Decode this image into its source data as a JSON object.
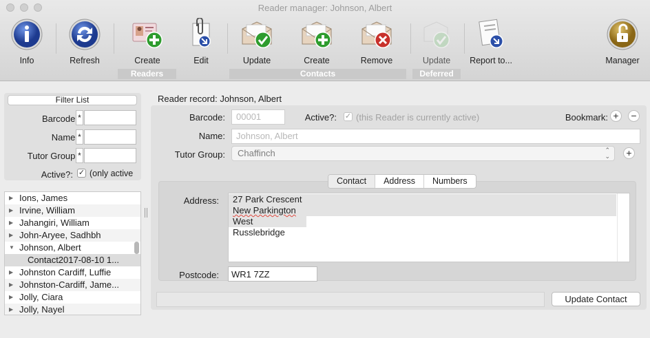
{
  "window": {
    "title": "Reader manager: Johnson, Albert"
  },
  "toolbar": {
    "info": "Info",
    "refresh": "Refresh",
    "create_reader": "Create",
    "edit": "Edit",
    "update_contact": "Update",
    "create_contact": "Create",
    "remove": "Remove",
    "update_deferred": "Update",
    "report": "Report to...",
    "manager": "Manager",
    "groups": {
      "readers": "Readers",
      "contacts": "Contacts",
      "deferred": "Deferred"
    }
  },
  "filter": {
    "button": "Filter List",
    "barcode_label": "Barcode:",
    "name_label": "Name:",
    "tutor_label": "Tutor Group:",
    "active_label": "Active?:",
    "active_text": "(only active",
    "wildcard": "*"
  },
  "list": {
    "items": [
      {
        "name": "Ions,  James",
        "expanded": false
      },
      {
        "name": "Irvine,  William",
        "expanded": false
      },
      {
        "name": "Jahangiri,  William",
        "expanded": false
      },
      {
        "name": "John-Aryee,  Sadhbh",
        "expanded": false
      },
      {
        "name": "Johnson, Albert",
        "expanded": true
      },
      {
        "name": "Contact2017-08-10 1...",
        "child": true
      },
      {
        "name": "Johnston Cardiff,  Luffie",
        "expanded": false
      },
      {
        "name": "Johnston-Cardiff,  Jame...",
        "expanded": false
      },
      {
        "name": "Jolly,  Ciara",
        "expanded": false
      },
      {
        "name": "Jolly,  Nayel",
        "expanded": false
      }
    ]
  },
  "record": {
    "heading": "Reader record: Johnson, Albert",
    "barcode_label": "Barcode:",
    "barcode_value": "00001",
    "active_label": "Active?:",
    "active_text": "(this Reader is currently active)",
    "bookmark_label": "Bookmark:",
    "name_label": "Name:",
    "name_value": "Johnson, Albert",
    "tutor_label": "Tutor Group:",
    "tutor_value": "Chaffinch",
    "tabs": [
      "Contact",
      "Address",
      "Numbers"
    ],
    "active_tab": "Contact",
    "address_label": "Address:",
    "address_lines": [
      "27 Park Crescent",
      "New Parkington",
      "West Russlebridge"
    ],
    "postcode_label": "Postcode:",
    "postcode_value": "WR1 7ZZ",
    "update_button": "Update Contact"
  },
  "colors": {
    "accent_green": "#2e9c2e",
    "accent_red": "#c8312b",
    "info_blue": "#2b4fa8",
    "manager_gold": "#b88f2a"
  }
}
